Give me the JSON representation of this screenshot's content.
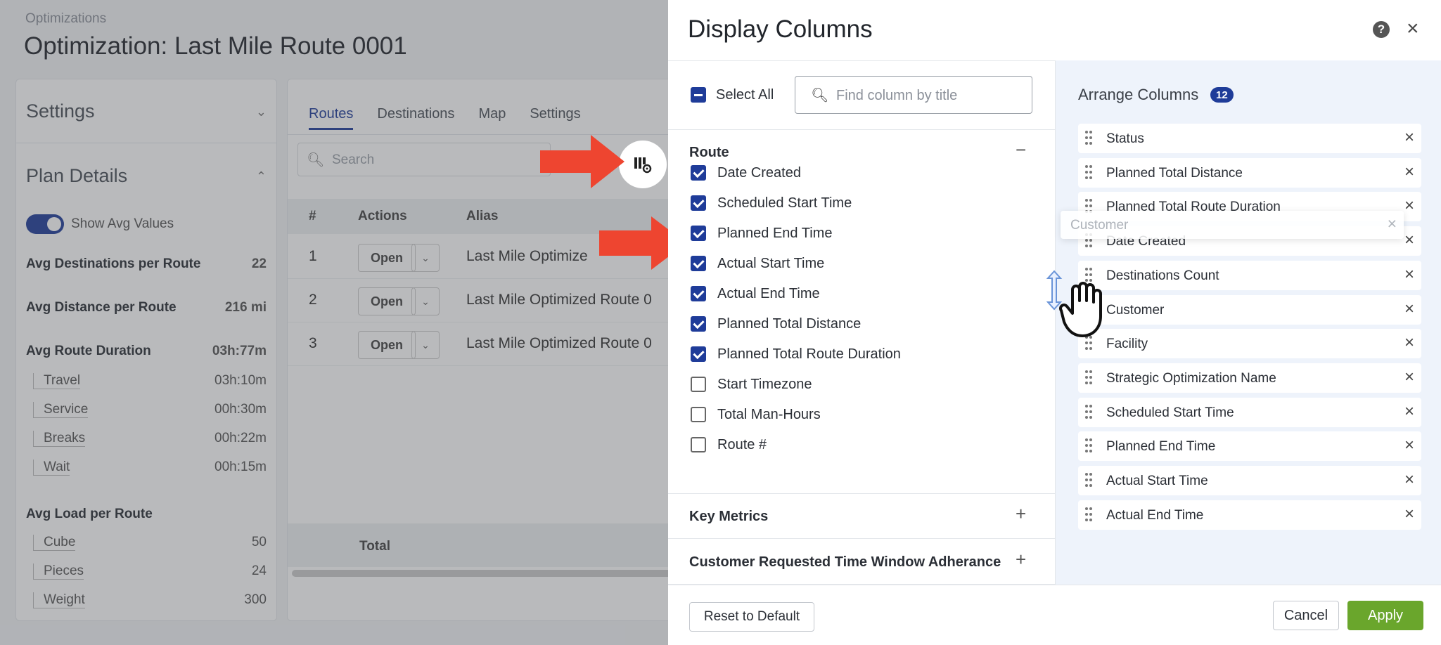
{
  "page": {
    "breadcrumb": "Optimizations",
    "title": "Optimization: Last Mile Route 0001"
  },
  "settings_panel": {
    "settings_label": "Settings",
    "plan_details_label": "Plan Details",
    "toggle_label": "Show Avg Values",
    "avg_destinations_label": "Avg Destinations per Route",
    "avg_destinations_value": "22",
    "avg_distance_label": "Avg Distance per Route",
    "avg_distance_value": "216 mi",
    "avg_duration_label": "Avg Route Duration",
    "avg_duration_value": "03h:77m",
    "duration_items": [
      {
        "label": "Travel",
        "value": "03h:10m"
      },
      {
        "label": "Service",
        "value": "00h:30m"
      },
      {
        "label": "Breaks",
        "value": "00h:22m"
      },
      {
        "label": "Wait",
        "value": "00h:15m"
      }
    ],
    "avg_load_label": "Avg Load per Route",
    "load_items": [
      {
        "label": "Cube",
        "value": "50"
      },
      {
        "label": "Pieces",
        "value": "24"
      },
      {
        "label": "Weight",
        "value": "300"
      }
    ]
  },
  "routes_panel": {
    "tabs": [
      "Routes",
      "Destinations",
      "Map",
      "Settings"
    ],
    "search_placeholder": "Search",
    "columns": [
      "#",
      "Actions",
      "Alias"
    ],
    "rows": [
      {
        "num": "1",
        "action": "Open",
        "alias": "Last Mile Optimize"
      },
      {
        "num": "2",
        "action": "Open",
        "alias": "Last Mile Optimized Route 0"
      },
      {
        "num": "3",
        "action": "Open",
        "alias": "Last Mile Optimized Route 0"
      }
    ],
    "total_label": "Total"
  },
  "drawer": {
    "title": "Display Columns",
    "select_all_label": "Select All",
    "find_placeholder": "Find column by title",
    "route_group_label": "Route",
    "route_columns": [
      {
        "label": "Date Created",
        "checked": true
      },
      {
        "label": "Scheduled Start Time",
        "checked": true
      },
      {
        "label": "Planned End Time",
        "checked": true
      },
      {
        "label": "Actual Start Time",
        "checked": true
      },
      {
        "label": "Actual End Time",
        "checked": true
      },
      {
        "label": "Planned Total Distance",
        "checked": true
      },
      {
        "label": "Planned Total Route Duration",
        "checked": true
      },
      {
        "label": "Start Timezone",
        "checked": false
      },
      {
        "label": "Total Man-Hours",
        "checked": false
      },
      {
        "label": "Route #",
        "checked": false
      }
    ],
    "key_metrics_label": "Key Metrics",
    "adherance_label": "Customer Requested Time Window Adherance",
    "arrange_title": "Arrange Columns",
    "arrange_count": "12",
    "arranged_columns": [
      "Status",
      "Planned Total Distance",
      "Planned Total Route Duration",
      "Date Created",
      "Destinations Count",
      "Customer",
      "Facility",
      "Strategic Optimization Name",
      "Scheduled Start Time",
      "Planned End Time",
      "Actual Start Time",
      "Actual End Time"
    ],
    "dragging_label": "Customer",
    "reset_label": "Reset to Default",
    "cancel_label": "Cancel",
    "apply_label": "Apply"
  },
  "colors": {
    "accent": "#1f3c99",
    "apply_green": "#6aa62c",
    "arrow_red": "#ee4530",
    "arrange_bg": "#eef3fb"
  }
}
